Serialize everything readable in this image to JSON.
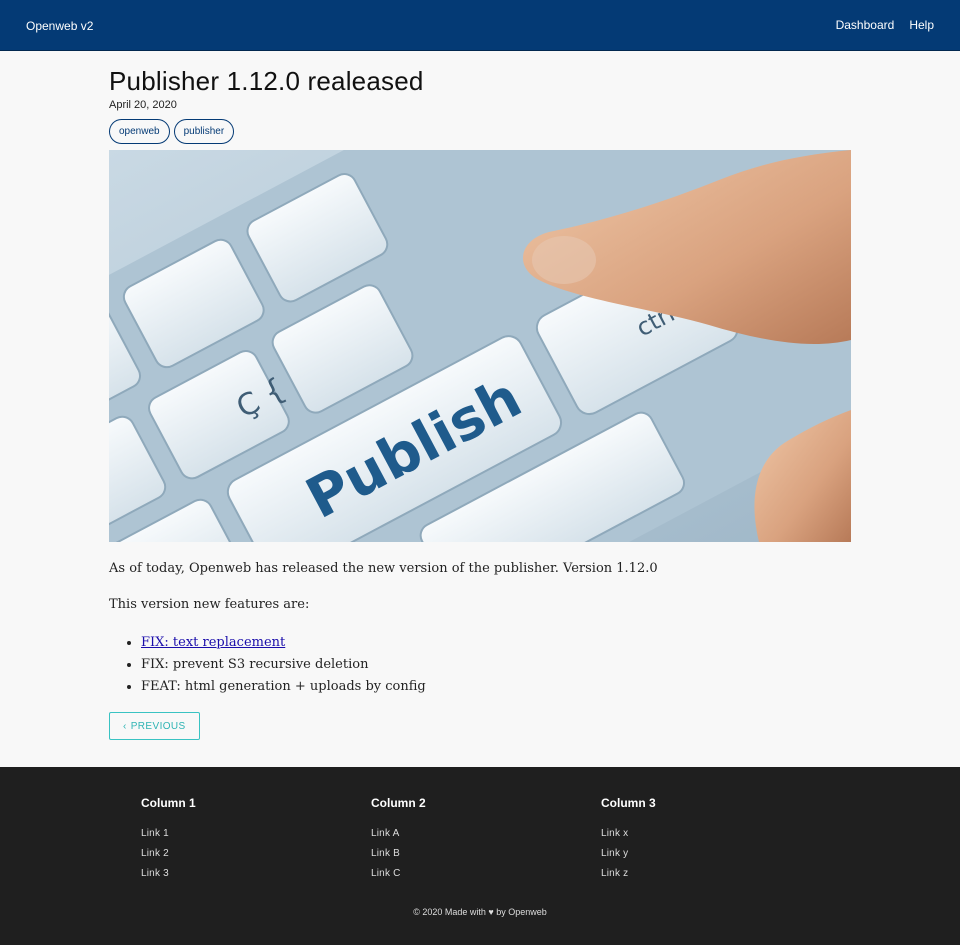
{
  "header": {
    "brand": "Openweb v2",
    "nav": [
      {
        "label": "Dashboard"
      },
      {
        "label": "Help"
      }
    ],
    "background": "#043a75"
  },
  "post": {
    "title": "Publisher 1.12.0 realeased",
    "date": "April 20, 2020",
    "tags": [
      "openweb",
      "publisher"
    ],
    "hero_image": {
      "icon": "keyboard-publish-key-image",
      "key_label": "Publish",
      "other_keys": [
        "ctrl",
        "alt"
      ]
    },
    "intro": "As of today, Openweb has released the new version of the publisher. Version 1.12.0",
    "features_heading": "This version new features are:",
    "features": [
      "FIX: text replacement",
      "FIX: prevent S3 recursive deletion",
      "FEAT: html generation + uploads by config"
    ],
    "previous_label": "PREVIOUS",
    "previous_icon": "chevron-left-icon"
  },
  "footer": {
    "columns": [
      {
        "title": "Column 1",
        "links": [
          "Link 1",
          "Link 2",
          "Link 3"
        ]
      },
      {
        "title": "Column 2",
        "links": [
          "Link A",
          "Link B",
          "Link C"
        ]
      },
      {
        "title": "Column 3",
        "links": [
          "Link x",
          "Link y",
          "Link z"
        ]
      }
    ],
    "copyright": "© 2020 Made with ♥ by Openweb"
  }
}
